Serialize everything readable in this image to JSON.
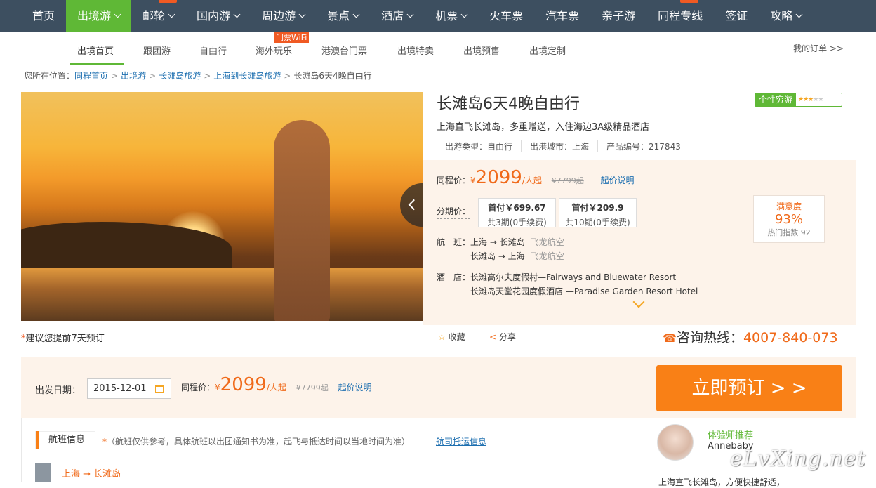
{
  "top_nav": [
    {
      "label": "首页",
      "dropdown": false
    },
    {
      "label": "出境游",
      "dropdown": true,
      "active": true
    },
    {
      "label": "邮轮",
      "dropdown": true
    },
    {
      "label": "国内游",
      "dropdown": true
    },
    {
      "label": "周边游",
      "dropdown": true
    },
    {
      "label": "景点",
      "dropdown": true
    },
    {
      "label": "酒店",
      "dropdown": true
    },
    {
      "label": "机票",
      "dropdown": true
    },
    {
      "label": "火车票",
      "dropdown": false
    },
    {
      "label": "汽车票",
      "dropdown": false
    },
    {
      "label": "亲子游",
      "dropdown": false
    },
    {
      "label": "同程专线",
      "dropdown": false
    },
    {
      "label": "签证",
      "dropdown": false
    },
    {
      "label": "攻略",
      "dropdown": true
    }
  ],
  "sub_nav": [
    "出境首页",
    "跟团游",
    "自由行",
    "海外玩乐",
    "港澳台门票",
    "出境特卖",
    "出境预售",
    "出境定制"
  ],
  "wifi_badge": "门票WiFi",
  "my_order": "我的订单 >>",
  "breadcrumb": {
    "prefix": "您所在位置：",
    "links": [
      "同程首页",
      "出境游",
      "长滩岛旅游",
      "上海到长滩岛旅游"
    ],
    "current": "长滩岛6天4晚自由行"
  },
  "product": {
    "title": "长滩岛6天4晚自由行",
    "badge_label": "个性穷游",
    "badge_stars": 3,
    "badge_total": 5,
    "subtitle": "上海直飞长滩岛，多重赠送，入住海边3A级精品酒店",
    "type": "出游类型：自由行",
    "depart_city": "出港城市：上海",
    "code": "产品编号：217843"
  },
  "price": {
    "label": "同程价：",
    "currency": "¥",
    "value": "2099",
    "unit": "/人起",
    "original": "¥7799起",
    "explain": "起价说明"
  },
  "installment": {
    "label": "分期价：",
    "options": [
      {
        "first": "首付￥699.67",
        "periods": "共3期(0手续费)"
      },
      {
        "first": "首付￥209.9",
        "periods": "共10期(0手续费)"
      }
    ]
  },
  "satisfaction": {
    "label": "满意度",
    "value": "93%",
    "hot": "热门指数 92"
  },
  "flights": {
    "label": "航　班：",
    "rows": [
      {
        "route": "上海 → 长滩岛",
        "airline": "飞龙航空"
      },
      {
        "route": "长滩岛 → 上海",
        "airline": "飞龙航空"
      }
    ]
  },
  "hotels": {
    "label": "酒　店：",
    "rows": [
      "长滩高尔夫度假村—Fairways and Bluewater Resort",
      "长滩岛天堂花园度假酒店 —Paradise Garden Resort Hotel"
    ]
  },
  "advice": {
    "star": "*",
    "text": "建议您提前7天预订"
  },
  "actions": {
    "favorite": "收藏",
    "share": "分享"
  },
  "hotline": {
    "label": "咨询热线：",
    "number": "4007-840-073"
  },
  "booking": {
    "date_label": "出发日期：",
    "date_value": "2015-12-01",
    "price_label": "同程价：",
    "button": "立即预订 > >"
  },
  "flight_info": {
    "title": "航班信息",
    "note_star": "*",
    "note": "（航班仅供参考，具体航班以出团通知书为准，起飞与抵达时间以当地时间为准）",
    "link": "航司托运信息",
    "first_route": "上海 → 长滩岛"
  },
  "experience": {
    "title": "体验师推荐",
    "name": "Annebaby",
    "snippet": "上海直飞长滩岛，方便快捷舒适，"
  },
  "watermark": "eLvXing.net",
  "colors": {
    "nav_bg": "#3d4f60",
    "accent_green": "#5fb836",
    "price_orange": "#f06a1a",
    "book_button": "#f98016",
    "panel_bg": "#fdf3ea",
    "link_blue": "#1d6fb0"
  }
}
